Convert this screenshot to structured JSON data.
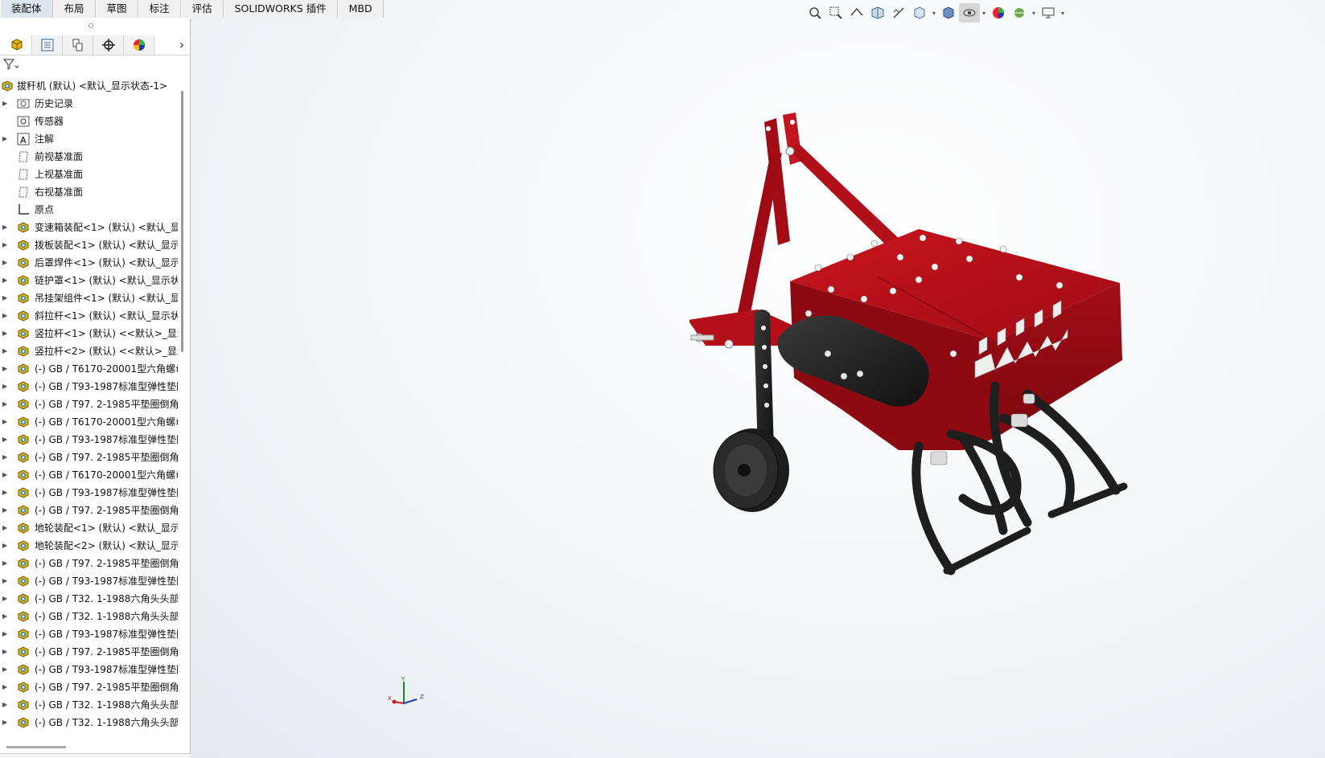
{
  "command_tabs": [
    "装配体",
    "布局",
    "草图",
    "标注",
    "评估",
    "SOLIDWORKS 插件",
    "MBD"
  ],
  "active_tab": "装配体",
  "panel_tabs": [
    "featuremanager-icon",
    "propertymanager-icon",
    "configurationmanager-icon",
    "dimxpert-icon",
    "display-manager-icon"
  ],
  "filter_icon": "filter-icon",
  "tree": {
    "root": "拔秆机 (默认) <默认_显示状态-1>",
    "items": [
      {
        "label": "历史记录",
        "icon": "history-icon",
        "arrow": true
      },
      {
        "label": "传感器",
        "icon": "sensor-icon",
        "arrow": false
      },
      {
        "label": "注解",
        "icon": "annotation-icon",
        "arrow": true
      },
      {
        "label": "前视基准面",
        "icon": "plane-icon",
        "arrow": false
      },
      {
        "label": "上视基准面",
        "icon": "plane-icon",
        "arrow": false
      },
      {
        "label": "右视基准面",
        "icon": "plane-icon",
        "arrow": false
      },
      {
        "label": "原点",
        "icon": "origin-icon",
        "arrow": false
      },
      {
        "label": "变速箱装配<1> (默认) <默认_显",
        "icon": "subassembly-icon",
        "arrow": true
      },
      {
        "label": "拨板装配<1> (默认) <默认_显示",
        "icon": "subassembly-icon",
        "arrow": true
      },
      {
        "label": "后罩焊件<1> (默认) <默认_显示",
        "icon": "subassembly-icon",
        "arrow": true
      },
      {
        "label": "链护罩<1> (默认) <默认_显示状",
        "icon": "subassembly-icon",
        "arrow": true
      },
      {
        "label": "吊挂架组件<1> (默认) <默认_显",
        "icon": "subassembly-icon",
        "arrow": true
      },
      {
        "label": "斜拉杆<1> (默认) <默认_显示状",
        "icon": "subassembly-icon",
        "arrow": true
      },
      {
        "label": "竖拉杆<1> (默认) <<默认>_显示",
        "icon": "subassembly-icon",
        "arrow": true
      },
      {
        "label": "竖拉杆<2> (默认) <<默认>_显示",
        "icon": "subassembly-icon",
        "arrow": true
      },
      {
        "label": "(-) GB / T6170-20001型六角螺母",
        "icon": "subassembly-icon",
        "arrow": true
      },
      {
        "label": "(-) GB / T93-1987标准型弹性垫圈",
        "icon": "subassembly-icon",
        "arrow": true
      },
      {
        "label": "(-) GB / T97. 2-1985平垫圈倒角",
        "icon": "subassembly-icon",
        "arrow": true
      },
      {
        "label": "(-) GB / T6170-20001型六角螺母",
        "icon": "subassembly-icon",
        "arrow": true
      },
      {
        "label": "(-) GB / T93-1987标准型弹性垫圈",
        "icon": "subassembly-icon",
        "arrow": true
      },
      {
        "label": "(-) GB / T97. 2-1985平垫圈倒角",
        "icon": "subassembly-icon",
        "arrow": true
      },
      {
        "label": "(-) GB / T6170-20001型六角螺母",
        "icon": "subassembly-icon",
        "arrow": true
      },
      {
        "label": "(-) GB / T93-1987标准型弹性垫圈",
        "icon": "subassembly-icon",
        "arrow": true
      },
      {
        "label": "(-) GB / T97. 2-1985平垫圈倒角",
        "icon": "subassembly-icon",
        "arrow": true
      },
      {
        "label": "地轮装配<1> (默认) <默认_显示",
        "icon": "subassembly-icon",
        "arrow": true
      },
      {
        "label": "地轮装配<2> (默认) <默认_显示",
        "icon": "subassembly-icon",
        "arrow": true
      },
      {
        "label": "(-) GB / T97. 2-1985平垫圈倒角",
        "icon": "subassembly-icon",
        "arrow": true
      },
      {
        "label": "(-) GB / T93-1987标准型弹性垫圈",
        "icon": "subassembly-icon",
        "arrow": true
      },
      {
        "label": "(-) GB / T32. 1-1988六角头头部",
        "icon": "subassembly-icon",
        "arrow": true
      },
      {
        "label": "(-) GB / T32. 1-1988六角头头部",
        "icon": "subassembly-icon",
        "arrow": true
      },
      {
        "label": "(-) GB / T93-1987标准型弹性垫圈",
        "icon": "subassembly-icon",
        "arrow": true
      },
      {
        "label": "(-) GB / T97. 2-1985平垫圈倒角",
        "icon": "subassembly-icon",
        "arrow": true
      },
      {
        "label": "(-) GB / T93-1987标准型弹性垫圈",
        "icon": "subassembly-icon",
        "arrow": true
      },
      {
        "label": "(-) GB / T97. 2-1985平垫圈倒角",
        "icon": "subassembly-icon",
        "arrow": true
      },
      {
        "label": "(-) GB / T32. 1-1988六角头头部",
        "icon": "subassembly-icon",
        "arrow": true
      },
      {
        "label": "(-) GB / T32. 1-1988六角头头部",
        "icon": "subassembly-icon",
        "arrow": true
      }
    ]
  },
  "headsup_toolbar": [
    "zoom-to-fit-icon",
    "zoom-to-area-icon",
    "previous-view-icon",
    "section-view-icon",
    "dynamic-annotation-icon",
    "view-orientation-icon",
    "display-style-icon",
    "hide-show-items-icon",
    "edit-appearance-icon",
    "apply-scene-icon",
    "view-settings-icon"
  ],
  "window_controls": [
    "tile-left-icon",
    "tile-right-icon",
    "minimize-icon",
    "restore-icon",
    "close-icon"
  ],
  "task_pane": [
    "home-icon",
    "design-library-icon",
    "file-explorer-icon",
    "view-palette-icon",
    "appearances-icon",
    "custom-properties-icon"
  ],
  "colors": {
    "frame_red": "#9b0a12",
    "frame_red_light": "#c4161f",
    "tine_black": "#1c1c1c",
    "tab_active": "#dde6ef"
  },
  "triad_axes": [
    "Y",
    "X",
    "Z"
  ]
}
